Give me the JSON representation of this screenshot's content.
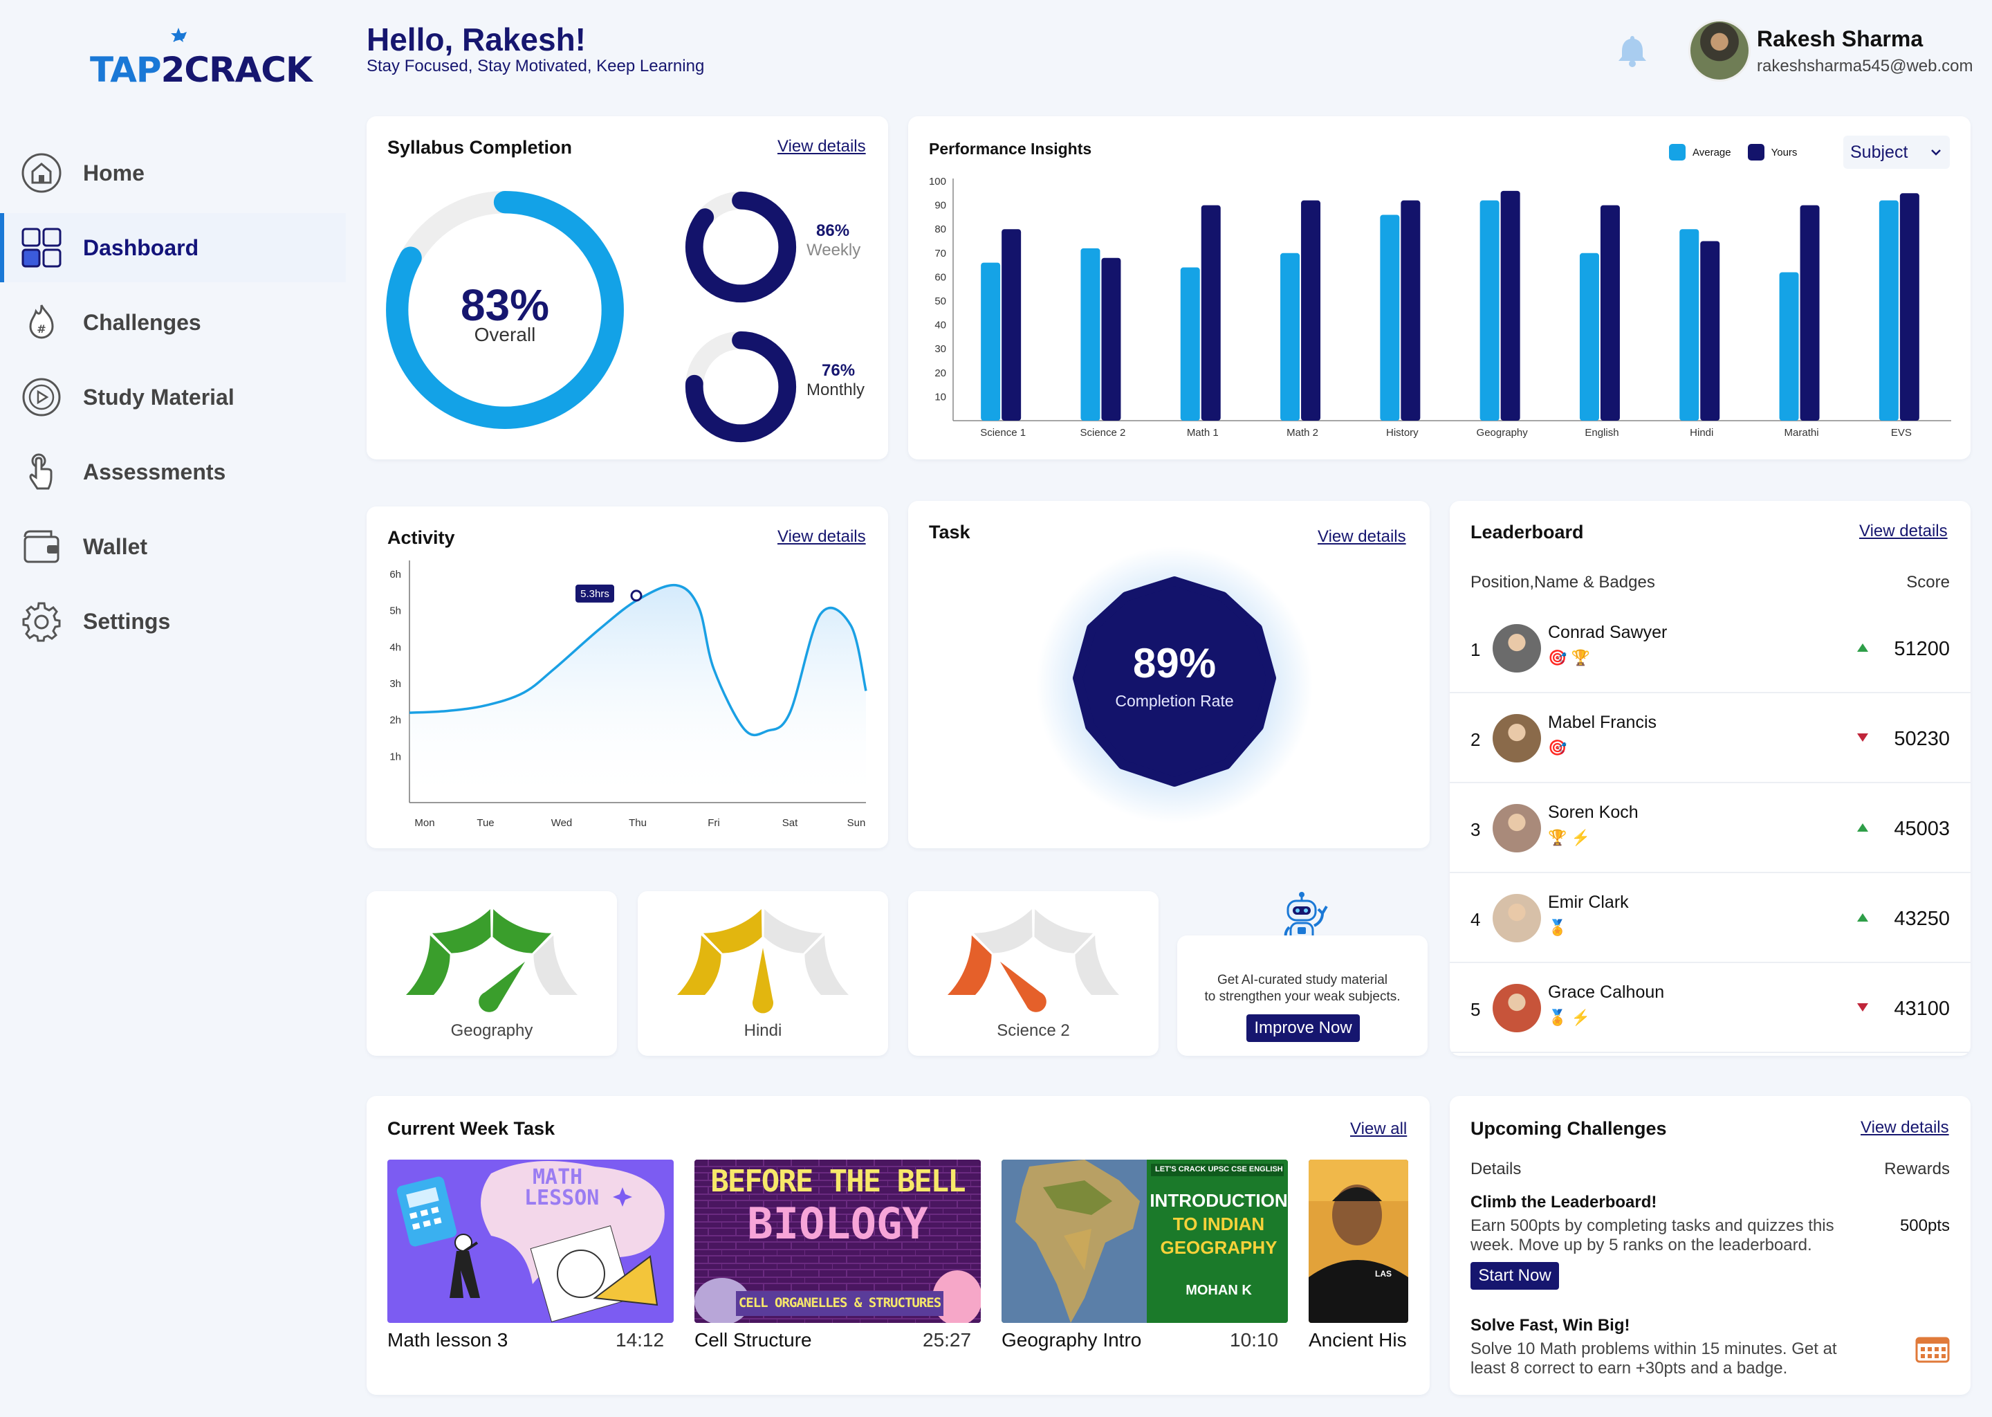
{
  "brand": {
    "logo_text_1": "TAP",
    "logo_text_2": "2",
    "logo_text_3": "CRACK"
  },
  "header": {
    "greeting": "Hello, Rakesh!",
    "subtitle": "Stay Focused, Stay Motivated, Keep Learning",
    "user_name": "Rakesh Sharma",
    "user_email": "rakeshsharma545@web.com"
  },
  "sidebar": {
    "items": [
      {
        "label": "Home",
        "icon": "home-icon"
      },
      {
        "label": "Dashboard",
        "icon": "dashboard-icon"
      },
      {
        "label": "Challenges",
        "icon": "flame-icon"
      },
      {
        "label": "Study Material",
        "icon": "play-icon"
      },
      {
        "label": "Assessments",
        "icon": "touch-icon"
      },
      {
        "label": "Wallet",
        "icon": "wallet-icon"
      },
      {
        "label": "Settings",
        "icon": "gear-icon"
      }
    ]
  },
  "syllabus": {
    "title": "Syllabus Completion",
    "view_label": "View details",
    "overall_value": "83%",
    "overall_label": "Overall",
    "overall_pct": 83,
    "weekly_value": "86%",
    "weekly_label": "Weekly",
    "weekly_pct": 86,
    "monthly_value": "76%",
    "monthly_label": "Monthly",
    "monthly_pct": 76
  },
  "performance": {
    "title": "Performance Insights",
    "legend_average": "Average",
    "legend_yours": "Yours",
    "filter_value": "Subject",
    "colors": {
      "average": "#15a3e6",
      "yours": "#13136b"
    }
  },
  "chart_data": [
    {
      "type": "bar",
      "title": "Performance Insights",
      "categories": [
        "Science 1",
        "Science 2",
        "Math 1",
        "Math 2",
        "History",
        "Geography",
        "English",
        "Hindi",
        "Marathi",
        "EVS"
      ],
      "series": [
        {
          "name": "Average",
          "values": [
            66,
            72,
            64,
            70,
            86,
            92,
            70,
            80,
            62,
            92
          ]
        },
        {
          "name": "Yours",
          "values": [
            80,
            68,
            90,
            92,
            92,
            96,
            90,
            75,
            90,
            95
          ]
        }
      ],
      "yticks": [
        10,
        20,
        30,
        40,
        50,
        60,
        70,
        80,
        90,
        100
      ],
      "ylim": [
        0,
        100
      ],
      "grid": false,
      "legend": "top-right"
    },
    {
      "type": "area",
      "title": "Activity",
      "categories": [
        "Mon",
        "Tue",
        "Wed",
        "Thu",
        "Fri",
        "Sat",
        "Sun"
      ],
      "yticks": [
        "1h",
        "2h",
        "3h",
        "4h",
        "5h",
        "6h"
      ],
      "ylim": [
        0,
        6
      ],
      "x": [
        0,
        0.5,
        1,
        1.5,
        1.9,
        2.5,
        3,
        3.5,
        3.8,
        4,
        4.4,
        4.7,
        5,
        5.4,
        5.8,
        6
      ],
      "y": [
        2.2,
        2.25,
        2.4,
        2.75,
        3.4,
        4.5,
        5.3,
        5.7,
        5.1,
        3.4,
        1.75,
        1.7,
        2.2,
        4.9,
        4.6,
        2.8
      ],
      "annotation": {
        "text": "5.3hrs",
        "x": 3,
        "y": 5.3
      }
    }
  ],
  "activity": {
    "title": "Activity",
    "view_label": "View details"
  },
  "task": {
    "title": "Task",
    "view_label": "View details",
    "value": "89%",
    "label": "Completion Rate"
  },
  "leaderboard": {
    "title": "Leaderboard",
    "view_label": "View details",
    "col_left": "Position,Name & Badges",
    "col_right": "Score",
    "rows": [
      {
        "pos": "1",
        "name": "Conrad Sawyer",
        "badges": "🎯 🏆",
        "score": "51200",
        "trend": "up",
        "avatar": "#6b6b6b"
      },
      {
        "pos": "2",
        "name": "Mabel Francis",
        "badges": "🎯",
        "score": "50230",
        "trend": "down",
        "avatar": "#8a6a4a"
      },
      {
        "pos": "3",
        "name": "Soren Koch",
        "badges": "🏆 ⚡",
        "score": "45003",
        "trend": "up",
        "avatar": "#a98a7a"
      },
      {
        "pos": "4",
        "name": "Emir Clark",
        "badges": "🏅",
        "score": "43250",
        "trend": "up",
        "avatar": "#d7c0a8"
      },
      {
        "pos": "5",
        "name": "Grace Calhoun",
        "badges": "🏅 ⚡",
        "score": "43100",
        "trend": "down",
        "avatar": "#c7543a"
      }
    ]
  },
  "gauges": [
    {
      "label": "Geography",
      "color": "#3a9e2c",
      "level": 0.75
    },
    {
      "label": "Hindi",
      "color": "#e2b60f",
      "level": 0.5
    },
    {
      "label": "Science 2",
      "color": "#e5602a",
      "level": 0.25
    }
  ],
  "ai": {
    "text_1": "Get AI-curated study material",
    "text_2": "to strengthen your weak subjects.",
    "button": "Improve Now"
  },
  "week_tasks": {
    "title": "Current Week Task",
    "view_label": "View all",
    "items": [
      {
        "name": "Math lesson 3",
        "time": "14:12",
        "thumb_text_1": "MATH",
        "thumb_text_2": "LESSON"
      },
      {
        "name": "Cell Structure",
        "time": "25:27",
        "thumb_text_1": "BEFORE THE BELL",
        "thumb_text_2": "BIOLOGY",
        "thumb_text_3": "CELL ORGANELLES & STRUCTURES"
      },
      {
        "name": "Geography Intro",
        "time": "10:10",
        "thumb_text_1": "INTRODUCTION",
        "thumb_text_2": "TO INDIAN",
        "thumb_text_3": "GEOGRAPHY",
        "thumb_text_4": "MOHAN K",
        "thumb_text_5": "LET'S CRACK UPSC CSE ENGLISH"
      },
      {
        "name": "Ancient His",
        "time": "",
        "thumb_text_1": "LAS"
      }
    ]
  },
  "challenges": {
    "title": "Upcoming Challenges",
    "view_label": "View details",
    "col_left": "Details",
    "col_right": "Rewards",
    "items": [
      {
        "title": "Climb the Leaderboard!",
        "desc_1": "Earn 500pts by completing tasks and quizzes this",
        "desc_2": "week. Move up by 5 ranks on the leaderboard.",
        "reward": "500pts",
        "button": "Start Now"
      },
      {
        "title": "Solve Fast, Win Big!",
        "desc_1": "Solve 10 Math problems within 15 minutes. Get at",
        "desc_2": "least 8 correct to earn +30pts and a badge.",
        "reward_icon": "calendar-icon"
      }
    ]
  }
}
